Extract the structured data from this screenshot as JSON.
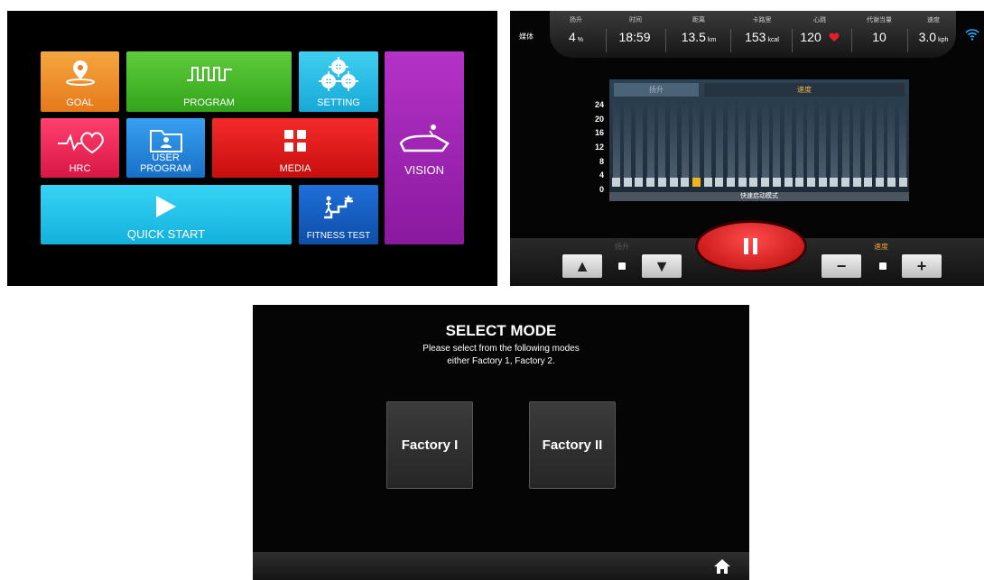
{
  "home_menu": {
    "tiles": {
      "goal": "GOAL",
      "program": "PROGRAM",
      "setting": "SETTING",
      "vision": "VISION",
      "hrc": "HRC",
      "user_program": "USER PROGRAM",
      "media": "MEDIA",
      "quick_start": "QUICK START",
      "fitness_test": "FITNESS TEST"
    },
    "icons": [
      "location-pin-icon",
      "program-waveform-icon",
      "gears-icon",
      "treadmill-icon",
      "heartbeat-icon",
      "user-folder-icon",
      "grid-icon",
      "play-icon",
      "stairs-runner-icon"
    ]
  },
  "workout": {
    "media_label": "媒体",
    "stats": [
      {
        "label": "扬升",
        "value": "4",
        "unit": "%"
      },
      {
        "label": "时间",
        "value": "18:59",
        "unit": ""
      },
      {
        "label": "距离",
        "value": "13.5",
        "unit": "km"
      },
      {
        "label": "卡路里",
        "value": "153",
        "unit": "kcal"
      },
      {
        "label": "心跳",
        "value": "120",
        "unit": ""
      },
      {
        "label": "代谢当量",
        "value": "10",
        "unit": ""
      },
      {
        "label": "速度",
        "value": "3.0",
        "unit": "kph"
      }
    ],
    "chart_tabs": {
      "incline": "扬升",
      "speed": "速度"
    },
    "y_ticks": [
      "24",
      "20",
      "16",
      "12",
      "8",
      "4",
      "0"
    ],
    "chart_footer": "快速启动模式",
    "chart_data": {
      "type": "bar",
      "segments": 26,
      "active_segment": 8,
      "values": [
        0,
        0,
        0,
        0,
        0,
        0,
        0,
        0,
        0,
        0,
        0,
        0,
        0,
        0,
        0,
        0,
        0,
        0,
        0,
        0,
        0,
        0,
        0,
        0,
        0,
        0
      ],
      "ylim": [
        0,
        24
      ],
      "ytick_labels": [
        "24",
        "20",
        "16",
        "12",
        "8",
        "4",
        "0"
      ],
      "xlabel": "快速启动模式",
      "title": ""
    },
    "incline_label": "扬升",
    "speed_label": "速度",
    "colors": {
      "accent_orange": "#f2b41b",
      "pause_red": "#e01818"
    }
  },
  "select_mode": {
    "title": "SELECT MODE",
    "subtitle_line1": "Please select from the following modes",
    "subtitle_line2": "either Factory 1, Factory 2.",
    "factory1": "Factory I",
    "factory2": "Factory II"
  }
}
